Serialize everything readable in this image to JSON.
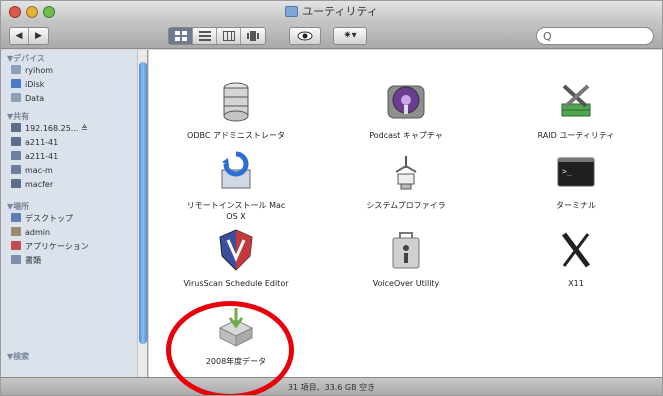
{
  "window": {
    "title": "ユーティリティ",
    "title_icon": "folder-icon"
  },
  "toolbar": {
    "back_icon": "chevron-left-icon",
    "forward_icon": "chevron-right-icon",
    "back_label": "◀",
    "forward_label": "▶",
    "view_modes": [
      "icon-view",
      "list-view",
      "column-view",
      "coverflow-view"
    ],
    "quick_look_icon": "eye-icon",
    "action_icon": "gear-icon",
    "action_label": "✷▾",
    "search_placeholder": "",
    "search_icon": "search-icon",
    "search_glyph": "Q"
  },
  "sidebar": {
    "sections": [
      {
        "header": "▼デバイス",
        "items": [
          {
            "label": "ryihom",
            "icon": "disk-icon",
            "color": "#8a9fb8"
          },
          {
            "label": "iDisk",
            "icon": "idisk-icon",
            "color": "#4b79c9"
          },
          {
            "label": "Data",
            "icon": "disk-icon",
            "color": "#8a9fb8"
          }
        ]
      },
      {
        "header": "▼共有",
        "items": [
          {
            "label": "192.168.25... ≜",
            "icon": "network-display-icon",
            "color": "#5a6e8e"
          },
          {
            "label": "a211-41",
            "icon": "network-display-icon",
            "color": "#5a6e8e"
          },
          {
            "label": "a211-41",
            "icon": "computer-icon",
            "color": "#6b7f9f"
          },
          {
            "label": "mac-m",
            "icon": "computer-icon",
            "color": "#6b7f9f"
          },
          {
            "label": "macfer",
            "icon": "network-display-icon",
            "color": "#5a6e8e"
          }
        ]
      },
      {
        "header": "▼場所",
        "items": [
          {
            "label": "デスクトップ",
            "icon": "desktop-icon",
            "color": "#5c7fb7"
          },
          {
            "label": "admin",
            "icon": "home-icon",
            "color": "#9c8a6a"
          },
          {
            "label": "アプリケーション",
            "icon": "applications-icon",
            "color": "#c24d4d"
          },
          {
            "label": "書類",
            "icon": "documents-icon",
            "color": "#7d8ea8"
          }
        ]
      },
      {
        "header": "▼検索",
        "items": []
      }
    ]
  },
  "apps": [
    {
      "label": "ODBC アドミニストレータ",
      "icon": "odbc-database-icon"
    },
    {
      "label": "Podcast キャプチャ",
      "icon": "podcast-capture-icon"
    },
    {
      "label": "RAID ユーティリティ",
      "icon": "raid-utility-icon"
    },
    {
      "label": "リモートインストール Mac\nOS X",
      "icon": "remote-install-icon"
    },
    {
      "label": "システムプロファイラ",
      "icon": "system-profiler-icon"
    },
    {
      "label": "ターミナル",
      "icon": "terminal-icon"
    },
    {
      "label": "VirusScan Schedule Editor",
      "icon": "virusscan-shield-icon"
    },
    {
      "label": "VoiceOver Utility",
      "icon": "voiceover-utility-icon"
    },
    {
      "label": "X11",
      "icon": "x11-icon"
    },
    {
      "label": "2008年度データ",
      "icon": "data-folder-icon"
    }
  ],
  "statusbar": {
    "text": "31 項目、33.6 GB 空き"
  },
  "annotation": {
    "color": "#e8000b",
    "target": "2008年度データ"
  }
}
